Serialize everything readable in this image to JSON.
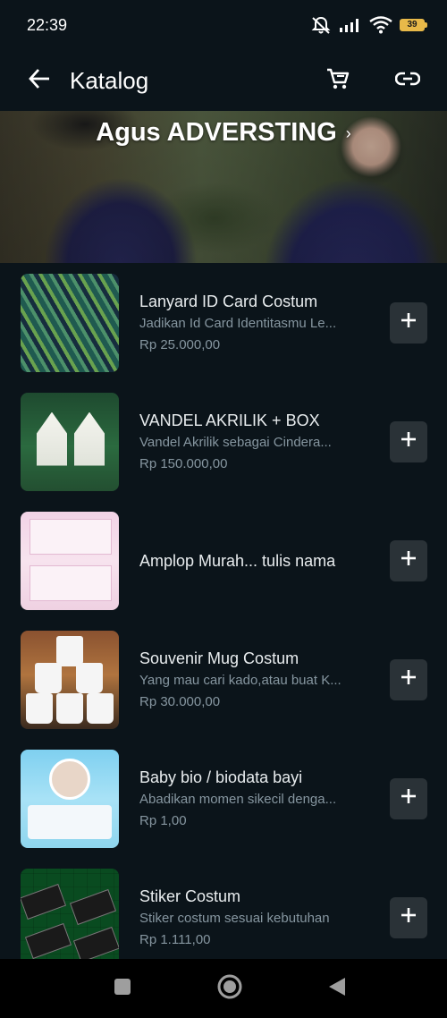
{
  "status_bar": {
    "time": "22:39",
    "battery_level": "39",
    "icons": [
      "mute-vibrate-icon",
      "signal-icon",
      "wifi-icon",
      "battery-icon"
    ]
  },
  "app_bar": {
    "title": "Katalog",
    "icons": [
      "back-arrow-icon",
      "cart-icon",
      "link-icon"
    ]
  },
  "banner": {
    "title": "Agus ADVERSTING",
    "chevron": "›"
  },
  "products": [
    {
      "name": "Lanyard ID Card Costum",
      "desc": "Jadikan Id Card Identitasmu Le...",
      "price": "Rp 25.000,00"
    },
    {
      "name": "VANDEL AKRILIK + BOX",
      "desc": "Vandel Akrilik sebagai Cindera...",
      "price": "Rp 150.000,00"
    },
    {
      "name": "Amplop Murah... tulis nama",
      "desc": "",
      "price": ""
    },
    {
      "name": "Souvenir Mug Costum",
      "desc": "Yang mau cari kado,atau buat K...",
      "price": "Rp 30.000,00"
    },
    {
      "name": "Baby bio / biodata bayi",
      "desc": "Abadikan momen sikecil denga...",
      "price": "Rp 1,00"
    },
    {
      "name": "Stiker Costum",
      "desc": "Stiker costum sesuai kebutuhan",
      "price": "Rp 1.111,00"
    }
  ],
  "add_button_icon": "plus-icon",
  "nav_bar": {
    "icons": [
      "recents-square-icon",
      "home-circle-icon",
      "back-triangle-icon"
    ]
  },
  "colors": {
    "background": "#0b141a",
    "add_button_bg": "#2a3237",
    "secondary_text": "#8696a0",
    "battery": "#e8b949"
  }
}
